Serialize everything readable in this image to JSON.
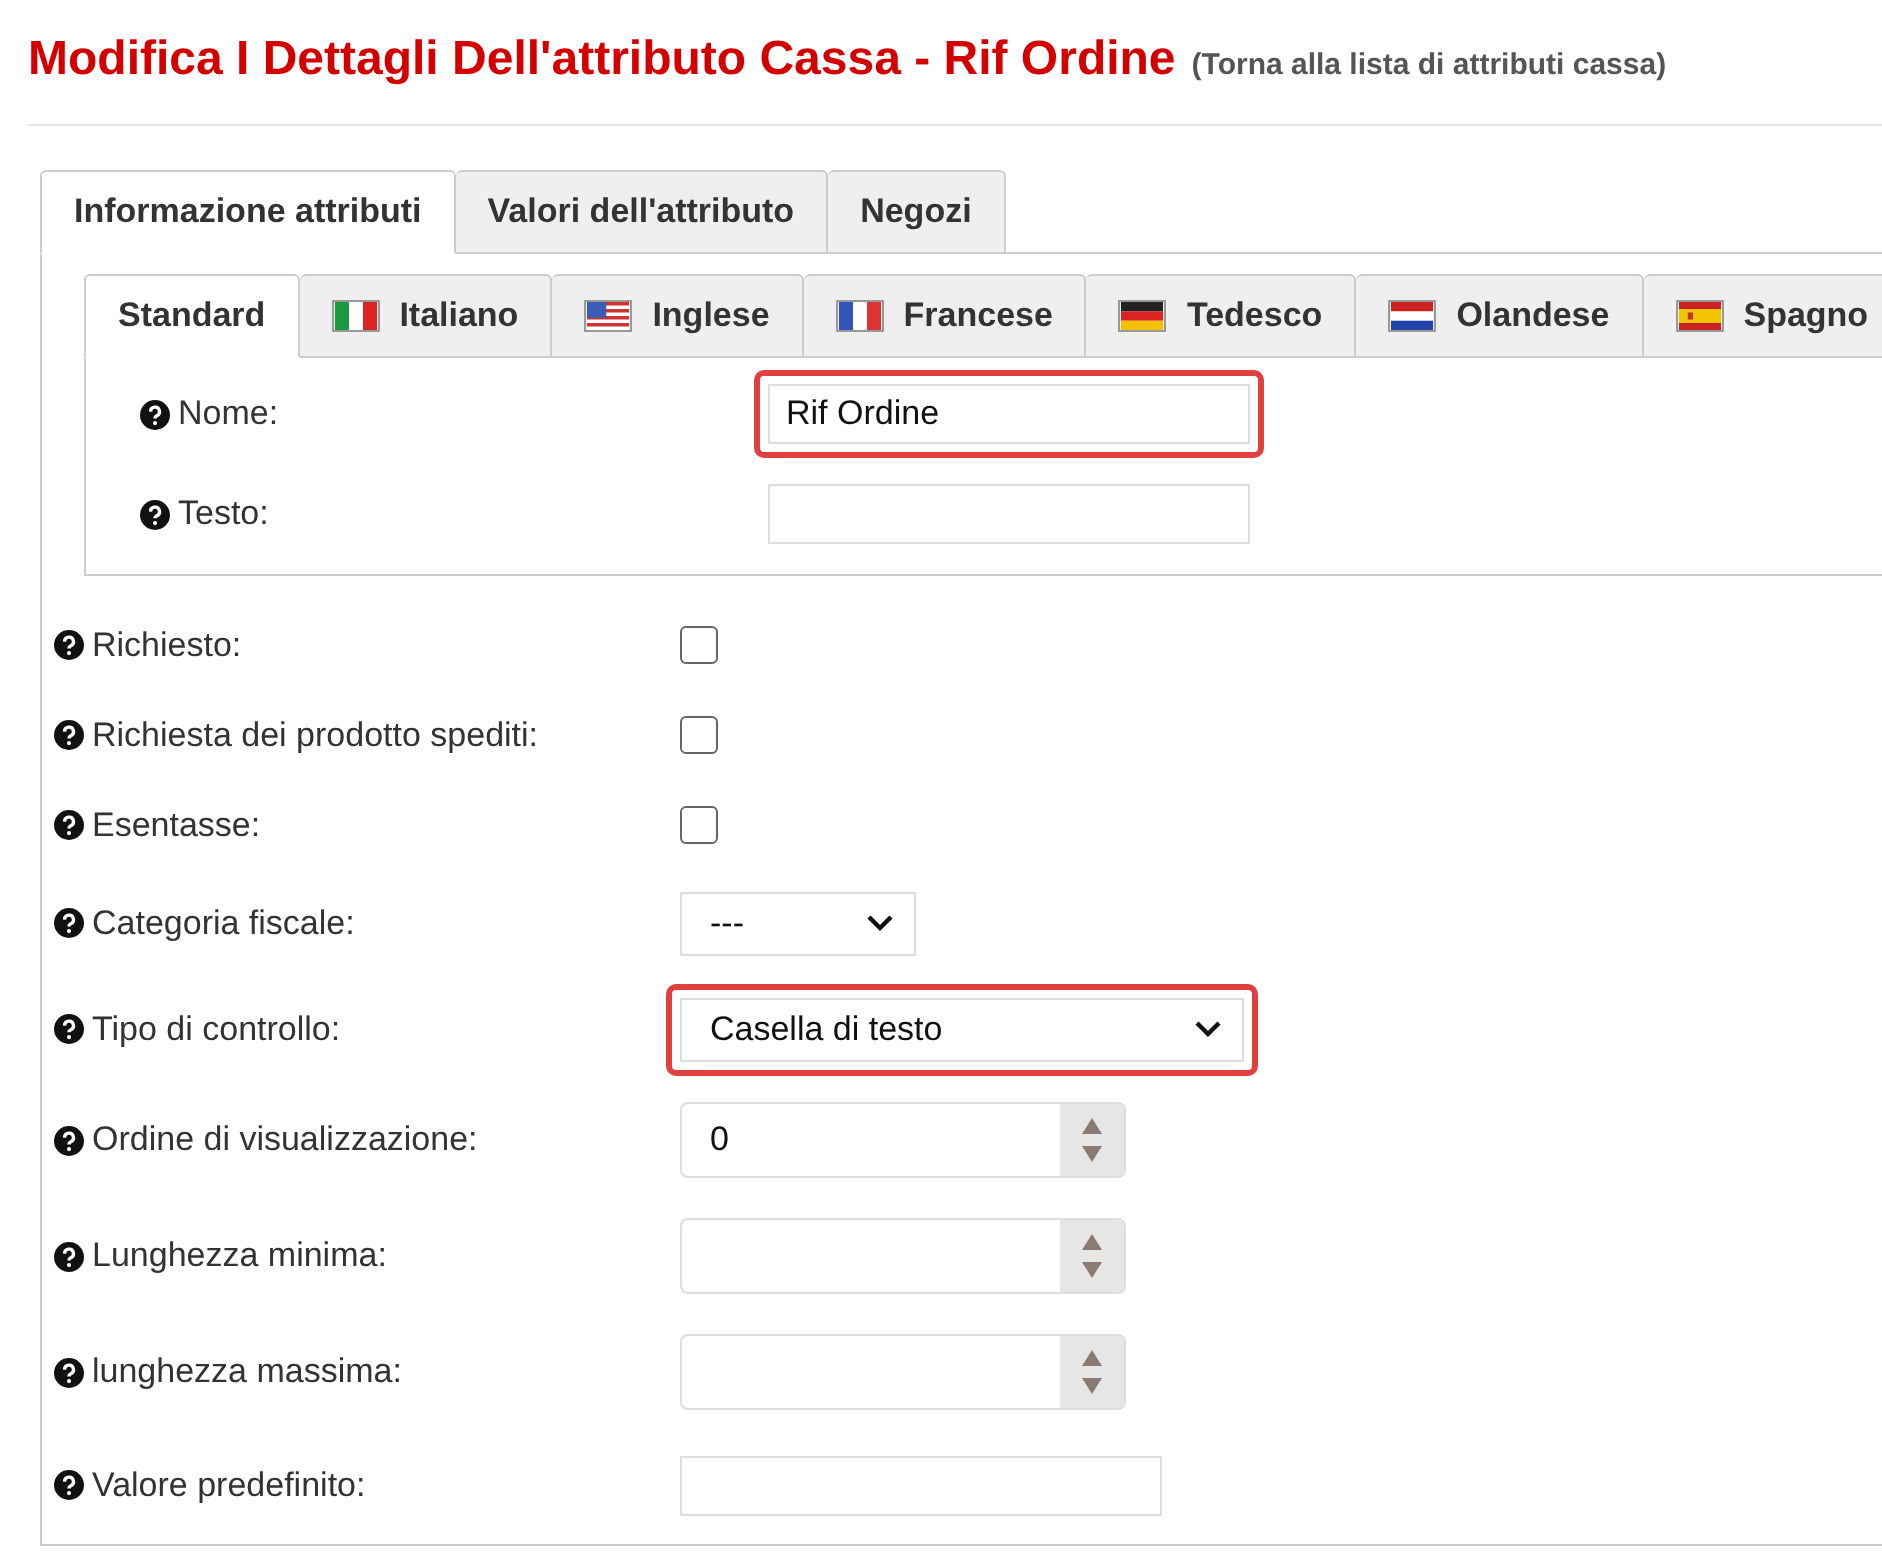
{
  "header": {
    "title": "Modifica I Dettagli Dell'attributo Cassa - Rif Ordine",
    "back_link": "(Torna alla lista di attributi cassa)"
  },
  "tabs": [
    {
      "label": "Informazione attributi",
      "selected": true
    },
    {
      "label": "Valori dell'attributo",
      "selected": false
    },
    {
      "label": "Negozi",
      "selected": false
    }
  ],
  "language_tabs": [
    {
      "label": "Standard",
      "kind": "plain",
      "selected": true
    },
    {
      "label": "Italiano",
      "kind": "flag",
      "selected": false
    },
    {
      "label": "Inglese",
      "kind": "flag",
      "selected": false
    },
    {
      "label": "Francese",
      "kind": "flag",
      "selected": false
    },
    {
      "label": "Tedesco",
      "kind": "flag",
      "selected": false
    },
    {
      "label": "Olandese",
      "kind": "flag",
      "selected": false
    },
    {
      "label": "Spagno",
      "kind": "flag",
      "selected": false
    }
  ],
  "language_fields": [
    {
      "label": "Nome:",
      "value": "Rif Ordine",
      "highlighted": true
    },
    {
      "label": "Testo:",
      "highlighted": false
    }
  ],
  "fields": [
    {
      "label": "Richiesto:",
      "kind": "checkbox",
      "checked": false
    },
    {
      "label": "Richiesta dei prodotto spediti:",
      "kind": "checkbox",
      "checked": false
    },
    {
      "label": "Esentasse:",
      "kind": "checkbox",
      "checked": false
    },
    {
      "label": "Categoria fiscale:",
      "kind": "select",
      "value": "---",
      "highlighted": false
    },
    {
      "label": "Tipo di controllo:",
      "kind": "select",
      "value": "Casella di testo",
      "highlighted": true
    },
    {
      "label": "Ordine di visualizzazione:",
      "kind": "number",
      "value": "0"
    },
    {
      "label": "Lunghezza minima:",
      "kind": "number"
    },
    {
      "label": "lunghezza massima:",
      "kind": "number"
    },
    {
      "label": "Valore predefinito:",
      "kind": "text"
    }
  ]
}
